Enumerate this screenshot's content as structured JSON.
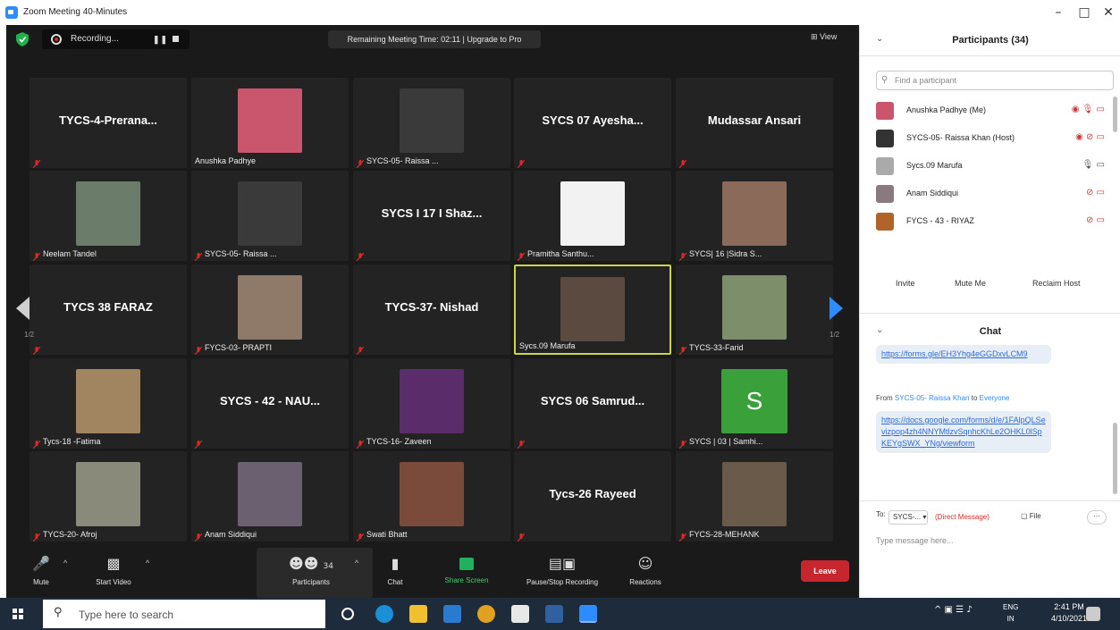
{
  "window": {
    "title": "Zoom Meeting 40-Minutes",
    "minimize": "–",
    "maximize": "□",
    "close": "✕"
  },
  "topbar": {
    "recording_label": "Recording...",
    "pause_glyph": "❚❚",
    "remaining_text": "Remaining Meeting Time: 02:11 | Upgrade to Pro",
    "view_label": "⊞ View"
  },
  "tiles": [
    {
      "type": "name",
      "name": "TYCS-4-Prerana..."
    },
    {
      "type": "photo",
      "caption": "Anushka Padhye",
      "color": "#c9566d",
      "muted": false
    },
    {
      "type": "photo",
      "caption": "SYCS-05- Raissa ...",
      "color": "#3a3a3a",
      "muted": true
    },
    {
      "type": "name",
      "name": "SYCS 07 Ayesha..."
    },
    {
      "type": "name",
      "name": "Mudassar Ansari"
    },
    {
      "type": "photo",
      "caption": "Neelam Tandel",
      "color": "#6b7d6a",
      "muted": true
    },
    {
      "type": "photo",
      "caption": "SYCS-05- Raissa ...",
      "color": "#3a3a3a",
      "muted": true
    },
    {
      "type": "name",
      "name": "SYCS I 17 I Shaz..."
    },
    {
      "type": "photo",
      "caption": "Pramitha Santhu...",
      "color": "#f2f2f2",
      "muted": true
    },
    {
      "type": "photo",
      "caption": "SYCS| 16 |Sidra S...",
      "color": "#8c6a5a",
      "muted": true
    },
    {
      "type": "name",
      "name": "TYCS 38 FARAZ"
    },
    {
      "type": "photo",
      "caption": "FYCS-03- PRAPTI",
      "color": "#8f7a6a",
      "muted": true
    },
    {
      "type": "name",
      "name": "TYCS-37- Nishad"
    },
    {
      "type": "photo",
      "caption": "Sycs.09 Marufa",
      "color": "#5a4a40",
      "muted": false,
      "active": true
    },
    {
      "type": "photo",
      "caption": "TYCS-33-Farid",
      "color": "#7d8f6a",
      "muted": true
    },
    {
      "type": "photo",
      "caption": "Tycs-18 -Fatima",
      "color": "#a08560",
      "muted": true
    },
    {
      "type": "name",
      "name": "SYCS - 42 - NAU..."
    },
    {
      "type": "photo",
      "caption": "TYCS-16- Zaveen",
      "color": "#5a2d6a",
      "muted": true
    },
    {
      "type": "name",
      "name": "SYCS 06 Samrud..."
    },
    {
      "type": "photo",
      "caption": "SYCS | 03 | Samhi...",
      "color": "#3aa03a",
      "letter": "S",
      "muted": true
    },
    {
      "type": "photo",
      "caption": "TYCS-20- Afroj",
      "color": "#8a8a7a",
      "muted": true
    },
    {
      "type": "photo",
      "caption": "Anam Siddiqui",
      "color": "#6a6070",
      "muted": true
    },
    {
      "type": "photo",
      "caption": "Swati Bhatt",
      "color": "#7a4a3a",
      "muted": true
    },
    {
      "type": "name",
      "name": "Tycs-26 Rayeed"
    },
    {
      "type": "photo",
      "caption": "FYCS-28-MEHANK",
      "color": "#6a5a4a",
      "muted": true
    }
  ],
  "pager": {
    "left": "1/2",
    "right": "1/2"
  },
  "toolbar": {
    "mute": "Mute",
    "start_video": "Start Video",
    "participants": "Participants",
    "participant_count": "34",
    "chat": "Chat",
    "share_screen": "Share Screen",
    "pause_recording": "Pause/Stop Recording",
    "reactions": "Reactions",
    "leave": "Leave"
  },
  "panel": {
    "title": "Participants (34)",
    "search_placeholder": "Find a participant",
    "participants": [
      {
        "name": "Anushka Padhye (Me)",
        "color": "#c9566d",
        "icons": "◉ 🎙 ▭",
        "icon_color": "#c93a3a"
      },
      {
        "name": "SYCS-05- Raissa Khan (Host)",
        "color": "#333333",
        "icons": "◉ ⊘ ▭",
        "icon_color": "#c93a3a"
      },
      {
        "name": "Sycs.09 Marufa",
        "color": "#aaaaaa",
        "icons": "🎙 ▭",
        "icon_color": "#555555"
      },
      {
        "name": "Anam Siddiqui",
        "color": "#8a7a80",
        "icons": "⊘ ▭",
        "icon_color": "#c93a3a"
      },
      {
        "name": "FYCS - 43 - RIYAZ",
        "color": "#b0642a",
        "icons": "⊘ ▭",
        "icon_color": "#c93a3a"
      }
    ],
    "invite": "Invite",
    "mute_me": "Mute Me",
    "reclaim_host": "Reclaim Host",
    "chat_title": "Chat",
    "link1": "https://forms.gle/EH3Yhg4eGGDxvLCM9",
    "from_prefix": "From",
    "from_name": "SYCS-05- Raissa Khan",
    "from_to": "to",
    "from_target": "Everyone",
    "link2": "https://docs.google.com/forms/d/e/1FAlpQLSevizpop4zh4NNYMtlzvSqnhcKhLe2OHKL0lSpKEYgSWX_YNg/viewform",
    "to_label": "To:",
    "to_value": "SYCS-... ▾",
    "direct_message": "(Direct Message)",
    "file": "▢ File",
    "more": "···",
    "type_placeholder": "Type message here..."
  },
  "taskbar": {
    "search_placeholder": "Type here to search",
    "lang": "ENG",
    "region": "IN",
    "time": "2:41 PM",
    "date": "4/10/2021"
  }
}
